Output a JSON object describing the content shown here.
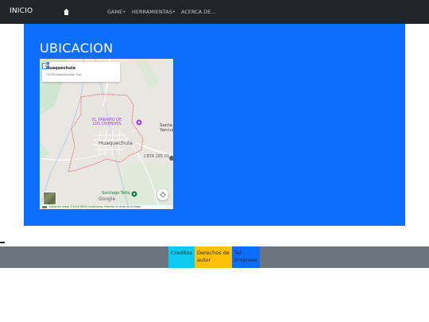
{
  "navbar": {
    "brand": "INICIO",
    "items": [
      {
        "label": "GAME",
        "caret": "▾"
      },
      {
        "label": "HERRAMIENTAS",
        "caret": "▾"
      },
      {
        "label": "ACERCA DE..."
      }
    ]
  },
  "hero": {
    "title": "UBICACION"
  },
  "map": {
    "place_name": "Huaquechula",
    "place_address": "74370 Huaquechula, Pue.",
    "labels": {
      "paramo": "EL PÁRAMO DE\nLOS DUENDES",
      "town": "Huaquechula",
      "santa": "Santa\nYancui",
      "cbta": "CBTA 185 01",
      "santiago": "Santiago Tetla",
      "google": "Google"
    },
    "attribution": "Datos del mapa ©2026 INEGI   Condiciones   Informar un error en el mapa"
  },
  "footer": {
    "creditos": "Creditos",
    "derechos": "Derechos de autor",
    "tel": "Tel: Empresa:"
  },
  "colors": {
    "navbar": "#212529",
    "hero": "#0d6efd",
    "footer": "#6c757d",
    "info": "#0dcaf0",
    "warning": "#ffc107",
    "primary": "#0d6efd"
  }
}
